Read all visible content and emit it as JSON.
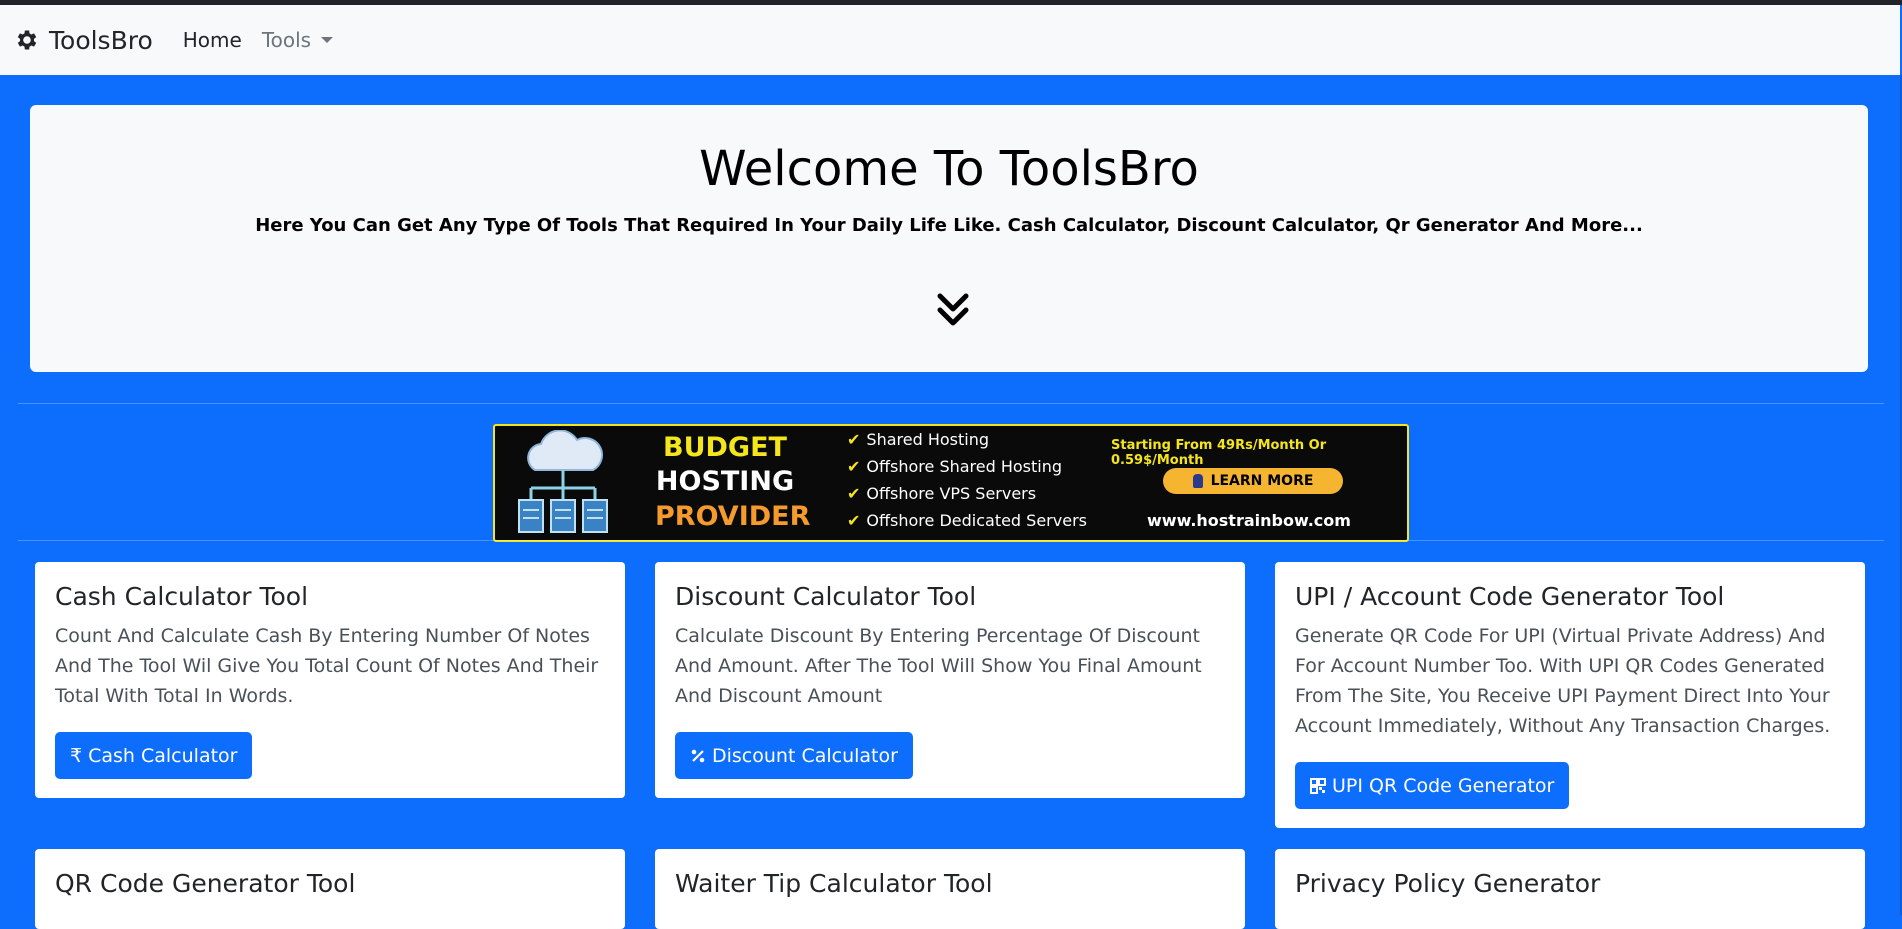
{
  "nav": {
    "brand": "ToolsBro",
    "brand_icon": "gear-icon",
    "home": "Home",
    "tools": "Tools"
  },
  "hero": {
    "title": "Welcome To ToolsBro",
    "subtitle": "Here You Can Get Any Type Of Tools That Required In Your Daily Life Like. Cash Calculator, Discount Calculator, Qr Generator And More...",
    "scroll_icon": "double-chevron-down-icon"
  },
  "banner": {
    "title_1": "BUDGET",
    "title_2": "HOSTING",
    "title_3": "PROVIDER",
    "features": [
      "Shared Hosting",
      "Offshore Shared Hosting",
      "Offshore VPS Servers",
      "Offshore Dedicated Servers"
    ],
    "pricing": "Starting From 49Rs/Month Or 0.59$/Month",
    "cta": "LEARN MORE",
    "url": "www.hostrainbow.com"
  },
  "cards": [
    {
      "title": "Cash Calculator Tool",
      "description": "Count And Calculate Cash By Entering Number Of Notes And The Tool Wil Give You Total Count Of Notes And Their Total With Total In Words.",
      "button": "Cash Calculator",
      "icon": "rupee-icon"
    },
    {
      "title": "Discount Calculator Tool",
      "description": "Calculate Discount By Entering Percentage Of Discount And Amount. After The Tool Will Show You Final Amount And Discount Amount",
      "button": "Discount Calculator",
      "icon": "percent-icon"
    },
    {
      "title": "UPI / Account Code Generator Tool",
      "description": "Generate QR Code For UPI (Virtual Private Address) And For Account Number Too. With UPI QR Codes Generated From The Site, You Receive UPI Payment Direct Into Your Account Immediately, Without Any Transaction Charges.",
      "button": "UPI QR Code Generator",
      "icon": "qr-icon"
    },
    {
      "title": "QR Code Generator Tool"
    },
    {
      "title": "Waiter Tip Calculator Tool"
    },
    {
      "title": "Privacy Policy Generator"
    }
  ],
  "colors": {
    "primary": "#0d6efd",
    "navbar": "#f8f9fa",
    "banner_yellow": "#f5e51b",
    "banner_orange": "#f59a2c"
  }
}
